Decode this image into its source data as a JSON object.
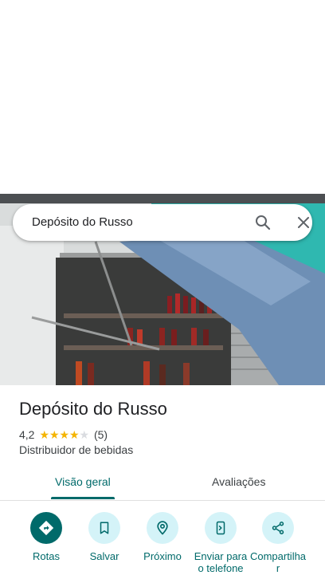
{
  "search": {
    "query": "Depósito do Russo",
    "search_icon": "search-icon",
    "close_icon": "close-icon"
  },
  "photo": {
    "description_icon": "storefront-photo"
  },
  "place": {
    "name": "Depósito do Russo",
    "rating": "4,2",
    "stars_filled": 4,
    "stars_total": 5,
    "review_count": "(5)",
    "category": "Distribuidor de bebidas"
  },
  "tabs": [
    {
      "label": "Visão geral",
      "selected": true
    },
    {
      "label": "Avaliações",
      "selected": false
    }
  ],
  "actions": [
    {
      "label": "Rotas",
      "icon": "directions-icon"
    },
    {
      "label": "Salvar",
      "icon": "bookmark-icon"
    },
    {
      "label": "Próximo",
      "icon": "nearby-icon"
    },
    {
      "label": "Enviar para o telefone",
      "icon": "send-to-phone-icon"
    },
    {
      "label": "Compartilhar",
      "icon": "share-icon"
    }
  ],
  "colors": {
    "accent": "#006a6a",
    "action_bg": "#d4f3f8",
    "star": "#f4b400"
  }
}
